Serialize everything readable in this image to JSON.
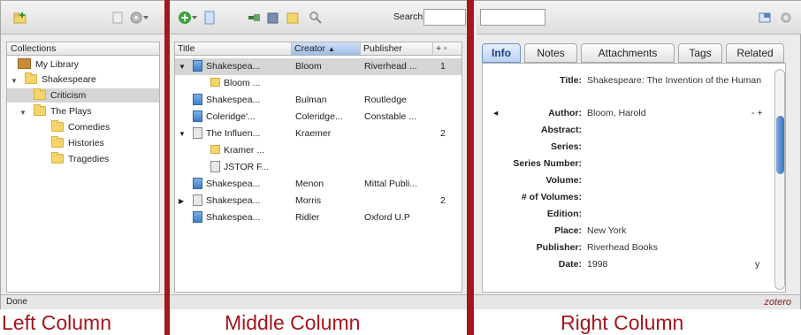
{
  "left": {
    "header": "Collections",
    "tree": [
      {
        "label": "My Library"
      },
      {
        "label": "Shakespeare"
      },
      {
        "label": "Criticism"
      },
      {
        "label": "The Plays"
      },
      {
        "label": "Comedies"
      },
      {
        "label": "Histories"
      },
      {
        "label": "Tragedies"
      }
    ]
  },
  "middle": {
    "search_label": "Search:",
    "search_value": "",
    "columns": {
      "title": "Title",
      "creator": "Creator",
      "publisher": "Publisher"
    },
    "rows": [
      {
        "title": "Shakespea...",
        "creator": "Bloom",
        "publisher": "Riverhead ...",
        "count": "1"
      },
      {
        "title": "Bloom ...",
        "creator": "",
        "publisher": "",
        "count": ""
      },
      {
        "title": "Shakespea...",
        "creator": "Bulman",
        "publisher": "Routledge",
        "count": ""
      },
      {
        "title": "Coleridge'...",
        "creator": "Coleridge...",
        "publisher": "Constable ...",
        "count": ""
      },
      {
        "title": "The Influen...",
        "creator": "Kraemer",
        "publisher": "",
        "count": "2"
      },
      {
        "title": "Kramer ...",
        "creator": "",
        "publisher": "",
        "count": ""
      },
      {
        "title": "JSTOR F...",
        "creator": "",
        "publisher": "",
        "count": ""
      },
      {
        "title": "Shakespea...",
        "creator": "Menon",
        "publisher": "Mittal Publi...",
        "count": ""
      },
      {
        "title": "Shakespea...",
        "creator": "Morris",
        "publisher": "",
        "count": "2"
      },
      {
        "title": "Shakespea...",
        "creator": "Ridler",
        "publisher": "Oxford U.P",
        "count": ""
      }
    ]
  },
  "right": {
    "tabs": [
      "Info",
      "Notes",
      "Attachments",
      "Tags",
      "Related"
    ],
    "fields": [
      {
        "label": "Title:",
        "value": "Shakespeare: The Invention of the Human"
      },
      {
        "label": "Author:",
        "value": "Bloom,   Harold"
      },
      {
        "label": "Abstract:",
        "value": ""
      },
      {
        "label": "Series:",
        "value": ""
      },
      {
        "label": "Series Number:",
        "value": ""
      },
      {
        "label": "Volume:",
        "value": ""
      },
      {
        "label": "# of Volumes:",
        "value": ""
      },
      {
        "label": "Edition:",
        "value": ""
      },
      {
        "label": "Place:",
        "value": "New York"
      },
      {
        "label": "Publisher:",
        "value": "Riverhead Books"
      },
      {
        "label": "Date:",
        "value": "1998"
      }
    ],
    "date_suffix": "y",
    "author_controls": "- +"
  },
  "status": {
    "text": "Done",
    "brand": "zotero"
  },
  "labels": {
    "left": "Left Column",
    "middle": "Middle Column",
    "right": "Right Column"
  },
  "colors": {
    "separator": "#a4171d",
    "label_text": "#a4171d",
    "selected_row": "#d5d5d5",
    "active_tab": "#b9d2f3"
  }
}
